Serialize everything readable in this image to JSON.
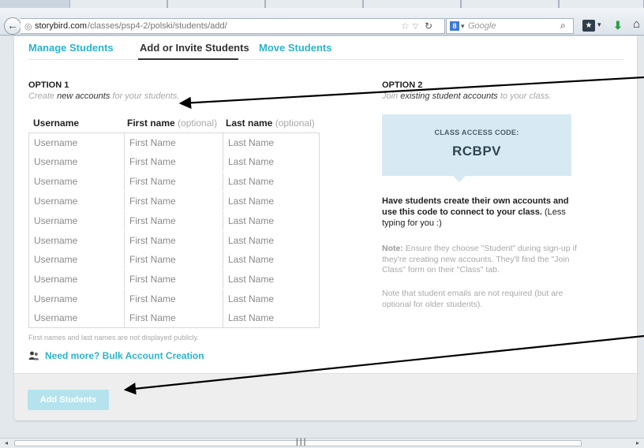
{
  "browser": {
    "url_host": "storybird.com",
    "url_path": "/classes/psp4-2/polski/students/add/",
    "search_engine_letter": "8",
    "search_placeholder": "Google"
  },
  "tabs": [
    {
      "label": "Manage Students",
      "active": false
    },
    {
      "label": "Add or Invite Students",
      "active": true
    },
    {
      "label": "Move Students",
      "active": false
    }
  ],
  "option1": {
    "title": "OPTION 1",
    "sub_prefix": "Create ",
    "sub_bold": "new accounts",
    "sub_suffix": " for your students."
  },
  "columns": {
    "username": "Username",
    "first_name": "First name",
    "last_name": "Last name",
    "optional": "(optional)"
  },
  "row_placeholders": {
    "username": "Username",
    "first_name": "First Name",
    "last_name": "Last Name"
  },
  "row_count": 10,
  "privacy_note": "First names and last names are not displayed publicly.",
  "bulk_link": "Need more? Bulk Account Creation",
  "option2": {
    "title": "OPTION 2",
    "sub_prefix": "Join ",
    "sub_bold": "existing student accounts",
    "sub_suffix": " to your class."
  },
  "access": {
    "label": "CLASS ACCESS CODE:",
    "code": "RCBPV"
  },
  "instructions": {
    "bold": "Have students create their own accounts and use this code to connect to your class.",
    "rest": " (Less typing for you :)"
  },
  "note1": {
    "bold": "Note:",
    "text": " Ensure they choose \"Student\" during sign-up if they're creating new accounts. They'll find the \"Join Class\" form on their \"Class\" tab."
  },
  "note2": "Note that student emails are not required (but are optional for older students).",
  "add_button": "Add Students",
  "colors": {
    "accent": "#2bb3cc",
    "access_box": "#d7eaf3",
    "button_disabled": "#b4e3ed"
  }
}
